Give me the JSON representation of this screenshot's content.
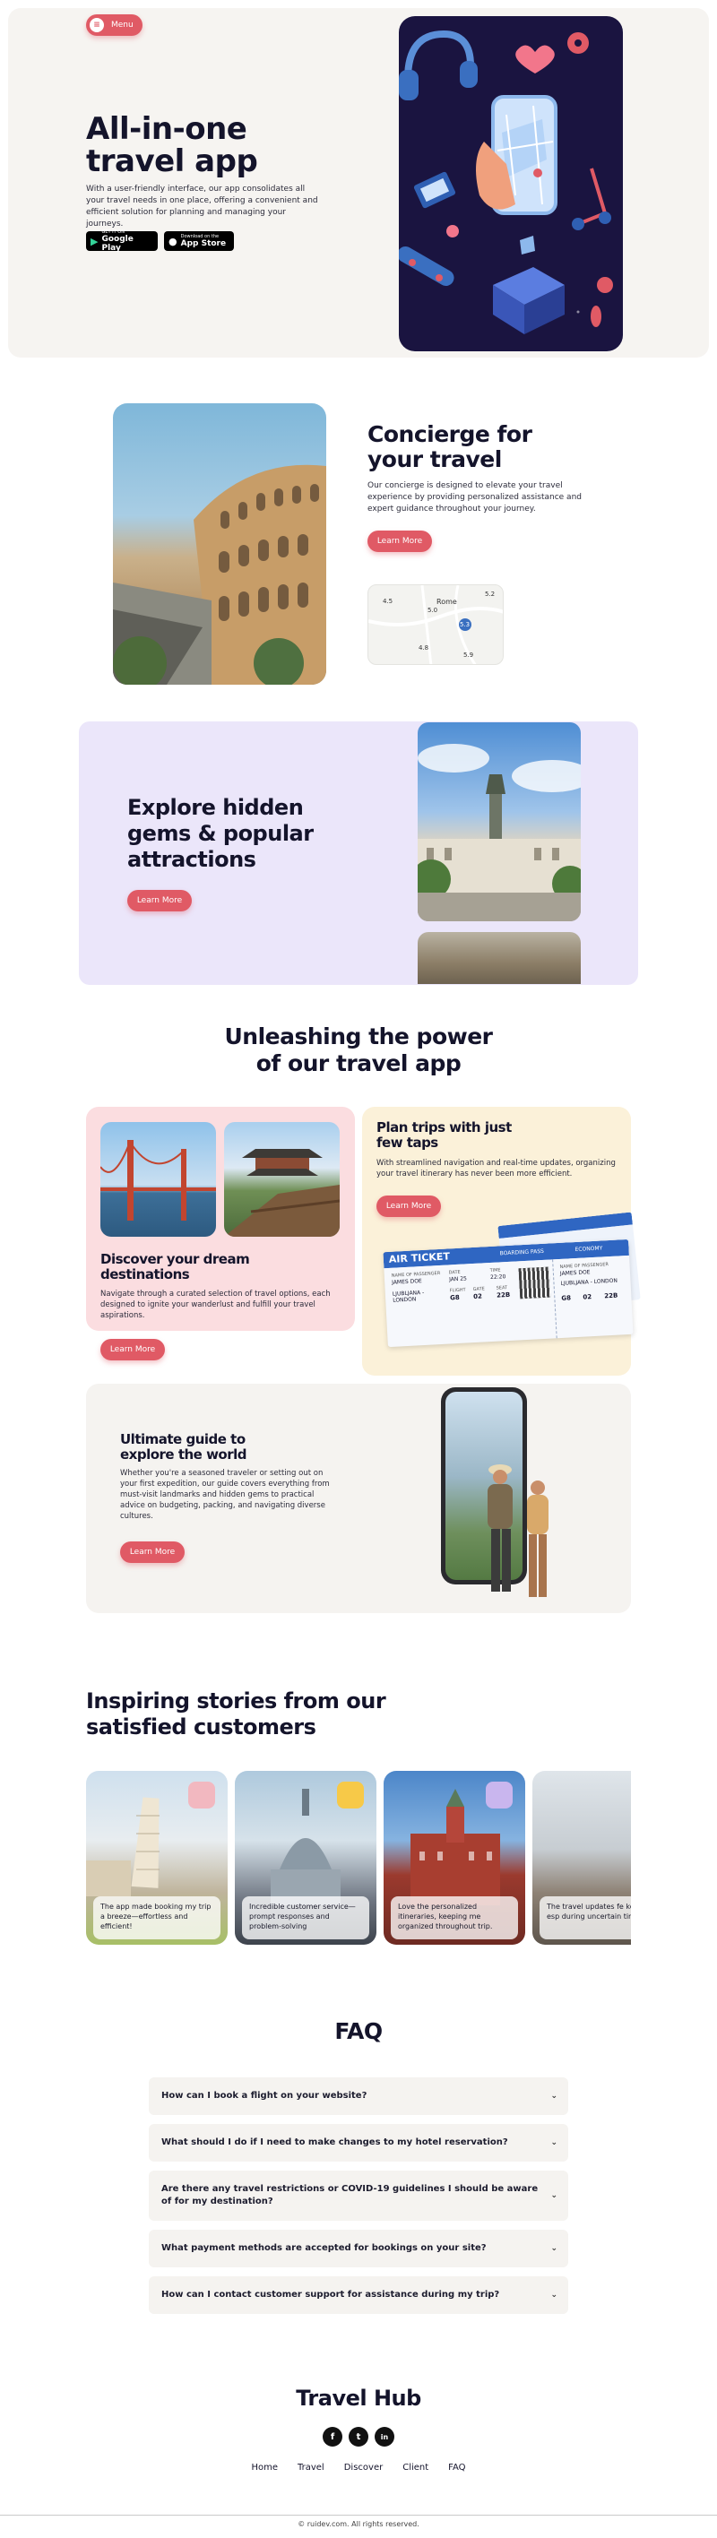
{
  "header": {
    "menu_label": "Menu"
  },
  "hero": {
    "title_line1": "All-in-one",
    "title_line2": "travel app",
    "description": "With a user-friendly interface, our app consolidates all your travel needs in one place, offering a convenient and efficient solution for planning and managing your journeys.",
    "google_play_small": "GET IT ON",
    "google_play_big": "Google Play",
    "app_store_small": "Download on the",
    "app_store_big": "App Store"
  },
  "concierge": {
    "title_line1": "Concierge for",
    "title_line2": "your travel",
    "description": "Our concierge is designed to elevate your travel experience by providing personalized assistance and expert guidance throughout your journey.",
    "button": "Learn More",
    "map": {
      "city": "Rome",
      "ratings": [
        "4.5",
        "5.0",
        "5.2",
        "5.3",
        "4.8",
        "5.9"
      ]
    }
  },
  "explore": {
    "title_line1": "Explore hidden",
    "title_line2": "gems & popular",
    "title_line3": "attractions",
    "button": "Learn More"
  },
  "power": {
    "title_line1": "Unleashing the power",
    "title_line2": "of our travel app"
  },
  "feature_discover": {
    "title_line1": "Discover your dream",
    "title_line2": "destinations",
    "description": "Navigate through a curated selection of travel options, each designed to ignite your wanderlust and fulfill your travel aspirations.",
    "button": "Learn More"
  },
  "feature_plan": {
    "title_line1": "Plan trips with just",
    "title_line2": "few taps",
    "description": "With streamlined navigation and real-time updates, organizing your travel itinerary has never been more efficient.",
    "button": "Learn More",
    "ticket": {
      "title": "AIR TICKET",
      "boarding": "BOARDING PASS",
      "economy": "ECONOMY",
      "name_label": "NAME OF PASSENGER",
      "name": "JAMES DOE",
      "route": "LJUBLJANA - LONDON",
      "date_label": "DATE",
      "date": "JAN 25",
      "time_label": "TIME",
      "time": "22:20",
      "flight_label": "FLIGHT",
      "flight": "G8",
      "gate_label": "GATE",
      "gate": "02",
      "seat_label": "SEAT",
      "seat": "22B"
    }
  },
  "feature_guide": {
    "title_line1": "Ultimate guide to",
    "title_line2": "explore the world",
    "description": "Whether you're a seasoned traveler or setting out on your first expedition, our guide covers everything from must-visit landmarks and hidden gems to practical advice on budgeting, packing, and navigating diverse cultures.",
    "button": "Learn More"
  },
  "stories": {
    "title_line1": "Inspiring stories from our",
    "title_line2": "satisfied customers",
    "items": [
      {
        "quote": "The app made booking my trip a breeze—effortless and efficient!"
      },
      {
        "quote": "Incredible customer service—prompt responses and problem-solving"
      },
      {
        "quote": "Love the personalized itineraries, keeping me organized throughout trip."
      },
      {
        "quote": "The travel updates fe kept me informed, esp during uncertain time"
      }
    ]
  },
  "faq": {
    "title": "FAQ",
    "items": [
      "How can I book a flight on your website?",
      "What should I do if I need to make changes to my hotel reservation?",
      "Are there any travel restrictions or COVID-19 guidelines I should be aware of for my destination?",
      "What payment methods are accepted for bookings on your site?",
      "How can I contact customer support for assistance during my trip?"
    ]
  },
  "footer": {
    "brand": "Travel Hub",
    "social": [
      "f",
      "t",
      "in"
    ],
    "links": [
      "Home",
      "Travel",
      "Discover",
      "Client",
      "FAQ"
    ],
    "copyright": "© ruidev.com. All rights reserved."
  },
  "colors": {
    "accent": "#e05a65",
    "hero_bg": "#f6f4f1",
    "lavender": "#ebe6fa",
    "pink_card": "#fbdde0",
    "cream_card": "#fbf1d9",
    "dark_navy": "#1a1440"
  }
}
